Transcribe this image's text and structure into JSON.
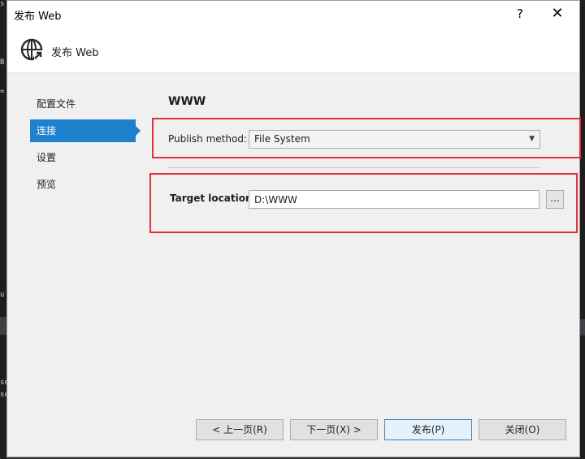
{
  "window": {
    "title": "发布 Web",
    "help_label": "?",
    "close_label": "✕"
  },
  "header": {
    "title": "发布 Web",
    "icon": "globe-arrow-icon"
  },
  "nav": {
    "items": [
      {
        "label": "配置文件"
      },
      {
        "label": "连接"
      },
      {
        "label": "设置"
      },
      {
        "label": "预览"
      }
    ],
    "active_index": 1
  },
  "main": {
    "section_title": "WWW",
    "publish_method_label": "Publish method:",
    "publish_method_value": "File System",
    "target_location_label": "Target location:",
    "target_location_value": "D:\\WWW",
    "browse_label": "..."
  },
  "footer": {
    "prev_label": "< 上一页(R)",
    "next_label": "下一页(X) >",
    "publish_label": "发布(P)",
    "close_label": "关闭(O)"
  },
  "background": {
    "glyphs": [
      "s",
      "B",
      "=",
      "u",
      "se",
      "se"
    ]
  },
  "colors": {
    "accent": "#1e81ce",
    "highlight": "#e0303a"
  }
}
